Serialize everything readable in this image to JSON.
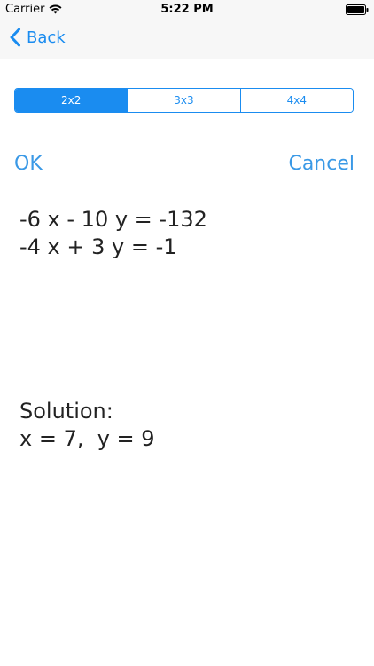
{
  "status_bar": {
    "carrier": "Carrier",
    "time": "5:22 PM"
  },
  "nav": {
    "back_label": "Back"
  },
  "segments": [
    {
      "label": "2x2",
      "selected": true
    },
    {
      "label": "3x3",
      "selected": false
    },
    {
      "label": "4x4",
      "selected": false
    }
  ],
  "actions": {
    "ok_label": "OK",
    "cancel_label": "Cancel"
  },
  "equations": [
    "-6 x - 10 y = -132",
    "-4 x + 3 y = -1"
  ],
  "solution": {
    "heading": "Solution:",
    "result": "x = 7,  y = 9"
  },
  "colors": {
    "accent": "#1a8cf0",
    "text": "#222222",
    "bar_background": "#f7f7f7"
  }
}
